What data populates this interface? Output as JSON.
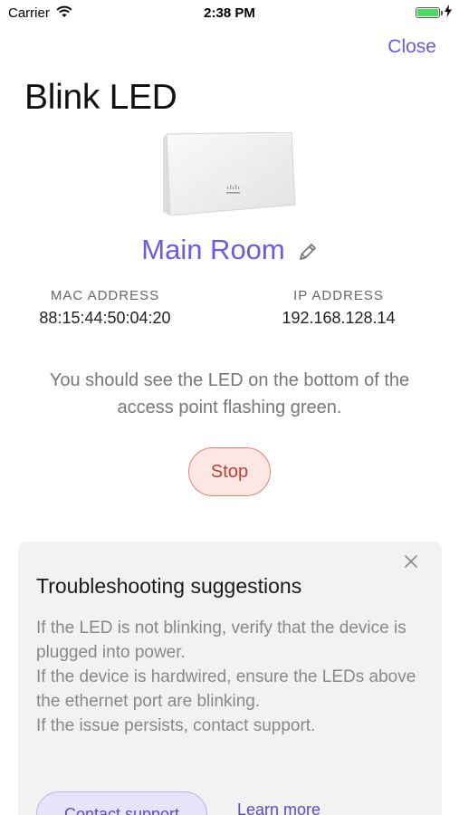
{
  "status_bar": {
    "carrier": "Carrier",
    "time": "2:38 PM",
    "battery_level": 1.0,
    "battery_color": "#4cd964"
  },
  "header": {
    "close_label": "Close",
    "title": "Blink LED"
  },
  "device": {
    "name": "Main Room",
    "image_icon": "access-point-image",
    "edit_icon": "pencil-icon"
  },
  "info": {
    "mac_label": "MAC ADDRESS",
    "mac_value": "88:15:44:50:04:20",
    "ip_label": "IP ADDRESS",
    "ip_value": "192.168.128.14"
  },
  "instructions": "You should see the LED on the bottom of the access point flashing green.",
  "stop_label": "Stop",
  "troubleshooting": {
    "title": "Troubleshooting suggestions",
    "lines": [
      "If the LED is not blinking, verify that the device is plugged into power.",
      "If the device is hardwired, ensure the LEDs above the ethernet port are blinking.",
      "If the issue persists, contact support."
    ],
    "contact_label": "Contact support",
    "learn_more_label": "Learn more"
  },
  "colors": {
    "accent": "#6b5be0",
    "stop_bg": "#fde7e4",
    "stop_border": "#e8806f",
    "card_bg": "#f2f2f2"
  }
}
